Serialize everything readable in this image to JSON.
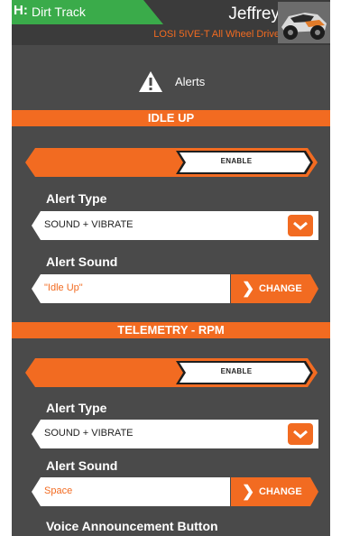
{
  "header": {
    "track_icon": "H:",
    "track_label": "Dirt Track",
    "model_name": "Jeffrey",
    "model_subtitle": "LOSI 5IVE-T All Wheel Drive"
  },
  "page": {
    "title": "Alerts",
    "icon": "warning-icon"
  },
  "sections": [
    {
      "title": "IDLE UP",
      "enable_label": "ENABLE",
      "alert_type_label": "Alert Type",
      "alert_type_value": "SOUND + VIBRATE",
      "alert_sound_label": "Alert Sound",
      "alert_sound_value": "\"Idle Up\"",
      "change_label": "CHANGE"
    },
    {
      "title": "TELEMETRY - RPM",
      "enable_label": "ENABLE",
      "alert_type_label": "Alert Type",
      "alert_type_value": "SOUND + VIBRATE",
      "alert_sound_label": "Alert Sound",
      "alert_sound_value": "Space",
      "change_label": "CHANGE",
      "voice_label": "Voice Announcement Button"
    }
  ],
  "colors": {
    "accent": "#f26b21",
    "track_green": "#3aab4a",
    "background": "#4a4a4a",
    "header": "#3b3b3b"
  }
}
